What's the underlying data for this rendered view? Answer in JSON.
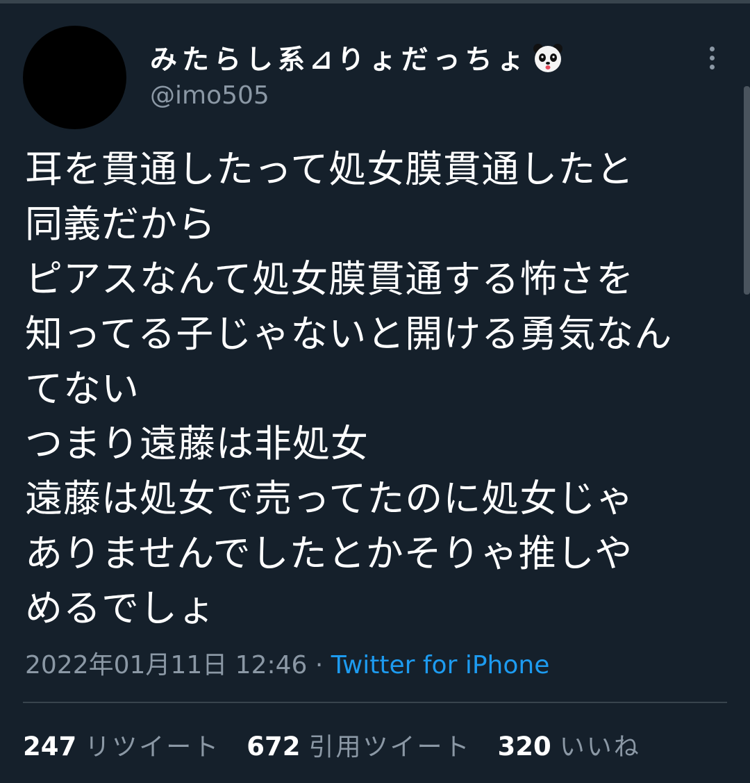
{
  "colors": {
    "background": "#15202b",
    "text_primary": "#ffffff",
    "text_secondary": "#8b98a5",
    "link": "#1d9bf0",
    "divider": "#38444d"
  },
  "tweet": {
    "display_name": "みたらし系⊿りょだっちょ",
    "display_name_emoji": "panda-face-icon",
    "handle": "@imo505",
    "more_icon": "more-vertical-icon",
    "text": "耳を貫通したって処女膜貫通したと\n同義だから\nピアスなんて処女膜貫通する怖さを\n知ってる子じゃないと開ける勇気なん\nてない\nつまり遠藤は非処女\n遠藤は処女で売ってたのに処女じゃ\nありませんでしたとかそりゃ推しや\nめるでしょ",
    "timestamp": "2022年01月11日 12:46",
    "separator": " · ",
    "source": "Twitter for iPhone"
  },
  "stats": {
    "retweets": {
      "count": "247",
      "label": "リツイート"
    },
    "quotes": {
      "count": "672",
      "label": "引用ツイート"
    },
    "likes": {
      "count": "320",
      "label": "いいね"
    }
  }
}
